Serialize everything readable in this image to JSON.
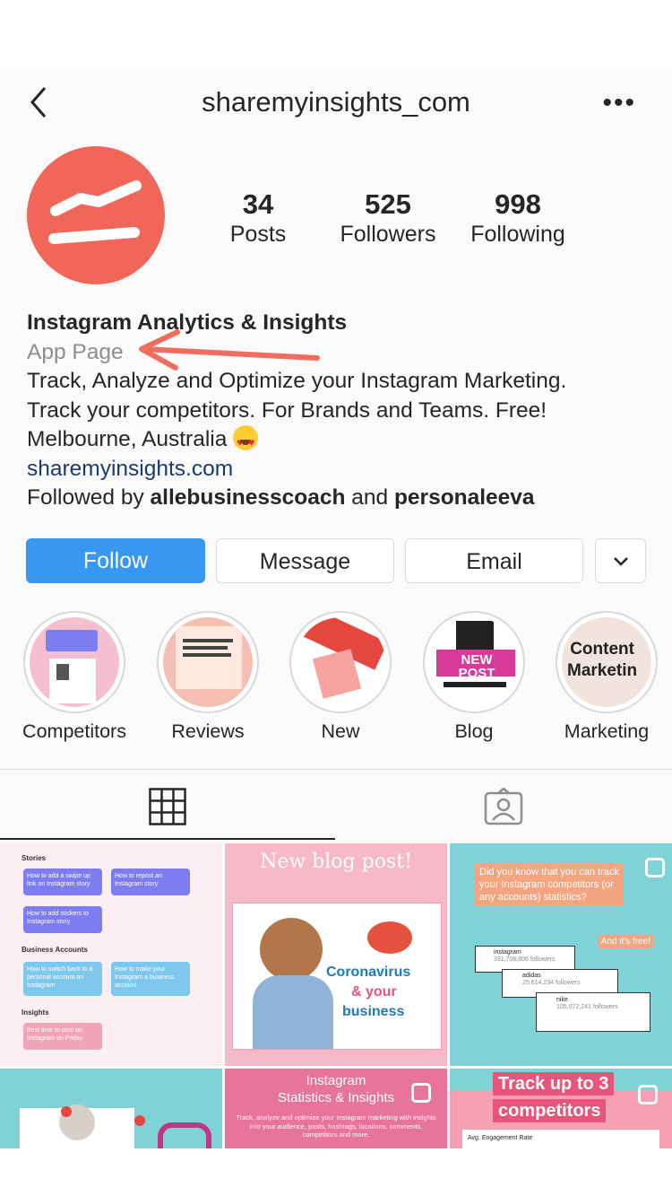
{
  "header": {
    "username": "sharemyinsights_com"
  },
  "stats": [
    {
      "value": "34",
      "label": "Posts"
    },
    {
      "value": "525",
      "label": "Followers"
    },
    {
      "value": "998",
      "label": "Following"
    }
  ],
  "bio": {
    "name": "Instagram Analytics & Insights",
    "category": "App Page",
    "line1": "Track, Analyze and Optimize your Instagram Marketing.",
    "line2": "Track your competitors. For Brands and Teams. Free!",
    "location": "Melbourne, Australia",
    "website": "sharemyinsights.com",
    "followed_prefix": "Followed by ",
    "followed_user1": "allebusinesscoach",
    "followed_and": " and ",
    "followed_user2": "personaleeva"
  },
  "buttons": {
    "follow": "Follow",
    "message": "Message",
    "email": "Email"
  },
  "highlights": [
    {
      "label": "Competitors"
    },
    {
      "label": "Reviews"
    },
    {
      "label": "New"
    },
    {
      "label": "Blog",
      "badge": "NEW POST"
    },
    {
      "label": "Marketing",
      "text1": "Content",
      "text2": "Marketin"
    }
  ],
  "posts": {
    "p1": {
      "stories": "Stories",
      "business": "Business Accounts",
      "insights": "Insights",
      "card1": "How to add a swipe up link on Instagram story",
      "card2": "How to repost an Instagram story",
      "card3": "How to add stickers to Instagram story",
      "card4": "How to switch back to a personal account on Instagram",
      "card5": "How to make your Instagram a business account",
      "card6": "Best time to post on Instagram on Friday"
    },
    "p2": {
      "title": "New blog post!",
      "text1": "Coronavirus",
      "text2": "& your",
      "text3": "business"
    },
    "p3": {
      "question": "Did you know that you can track your Instagram competitors (or any accounts) statistics?",
      "free": "And it's free!",
      "acc1": "instagram",
      "acc1f": "331,706,806 followers",
      "acc2": "adidas",
      "acc2f": "25,614,234 followers",
      "acc3": "nike",
      "acc3f": "105,072,241 followers"
    },
    "p5": {
      "title1": "Instagram",
      "title2": "Statistics & Insights",
      "sub": "Track, analyze and optimize your Instagram marketing with insights into your audience, posts, hashtags, locations, comments, competitors and more."
    },
    "p6": {
      "line1": "Track up to 3",
      "line2": "competitors",
      "small": "Avg. Engagement Rate"
    }
  },
  "colors": {
    "brand": "#f0675a",
    "follow": "#3897f0",
    "link": "#1b3b6f"
  }
}
